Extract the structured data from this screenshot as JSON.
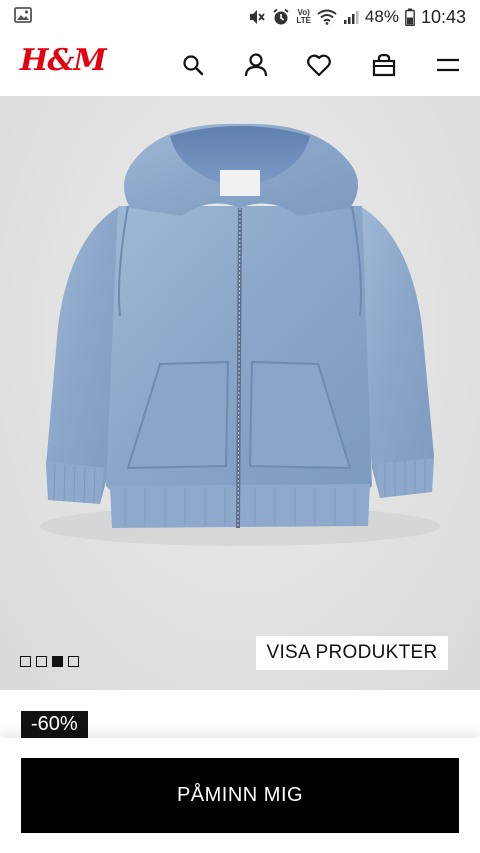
{
  "status_bar": {
    "volte_label": "Vo)",
    "lte_label": "LTE",
    "battery": "48%",
    "time": "10:43"
  },
  "header": {
    "logo": "H&M",
    "icons": [
      "search-icon",
      "account-icon",
      "favorites-icon",
      "shopping-bag-icon",
      "menu-icon"
    ]
  },
  "gallery": {
    "total_images": 4,
    "active_index": 2,
    "show_products_label": "VISA PRODUKTER"
  },
  "product": {
    "discount_badge": "-60%"
  },
  "actions": {
    "remind_label": "PÅMINN MIG"
  },
  "colors": {
    "brand_red": "#e50010",
    "button_black": "#000000",
    "denim": "#8aa6c9"
  }
}
